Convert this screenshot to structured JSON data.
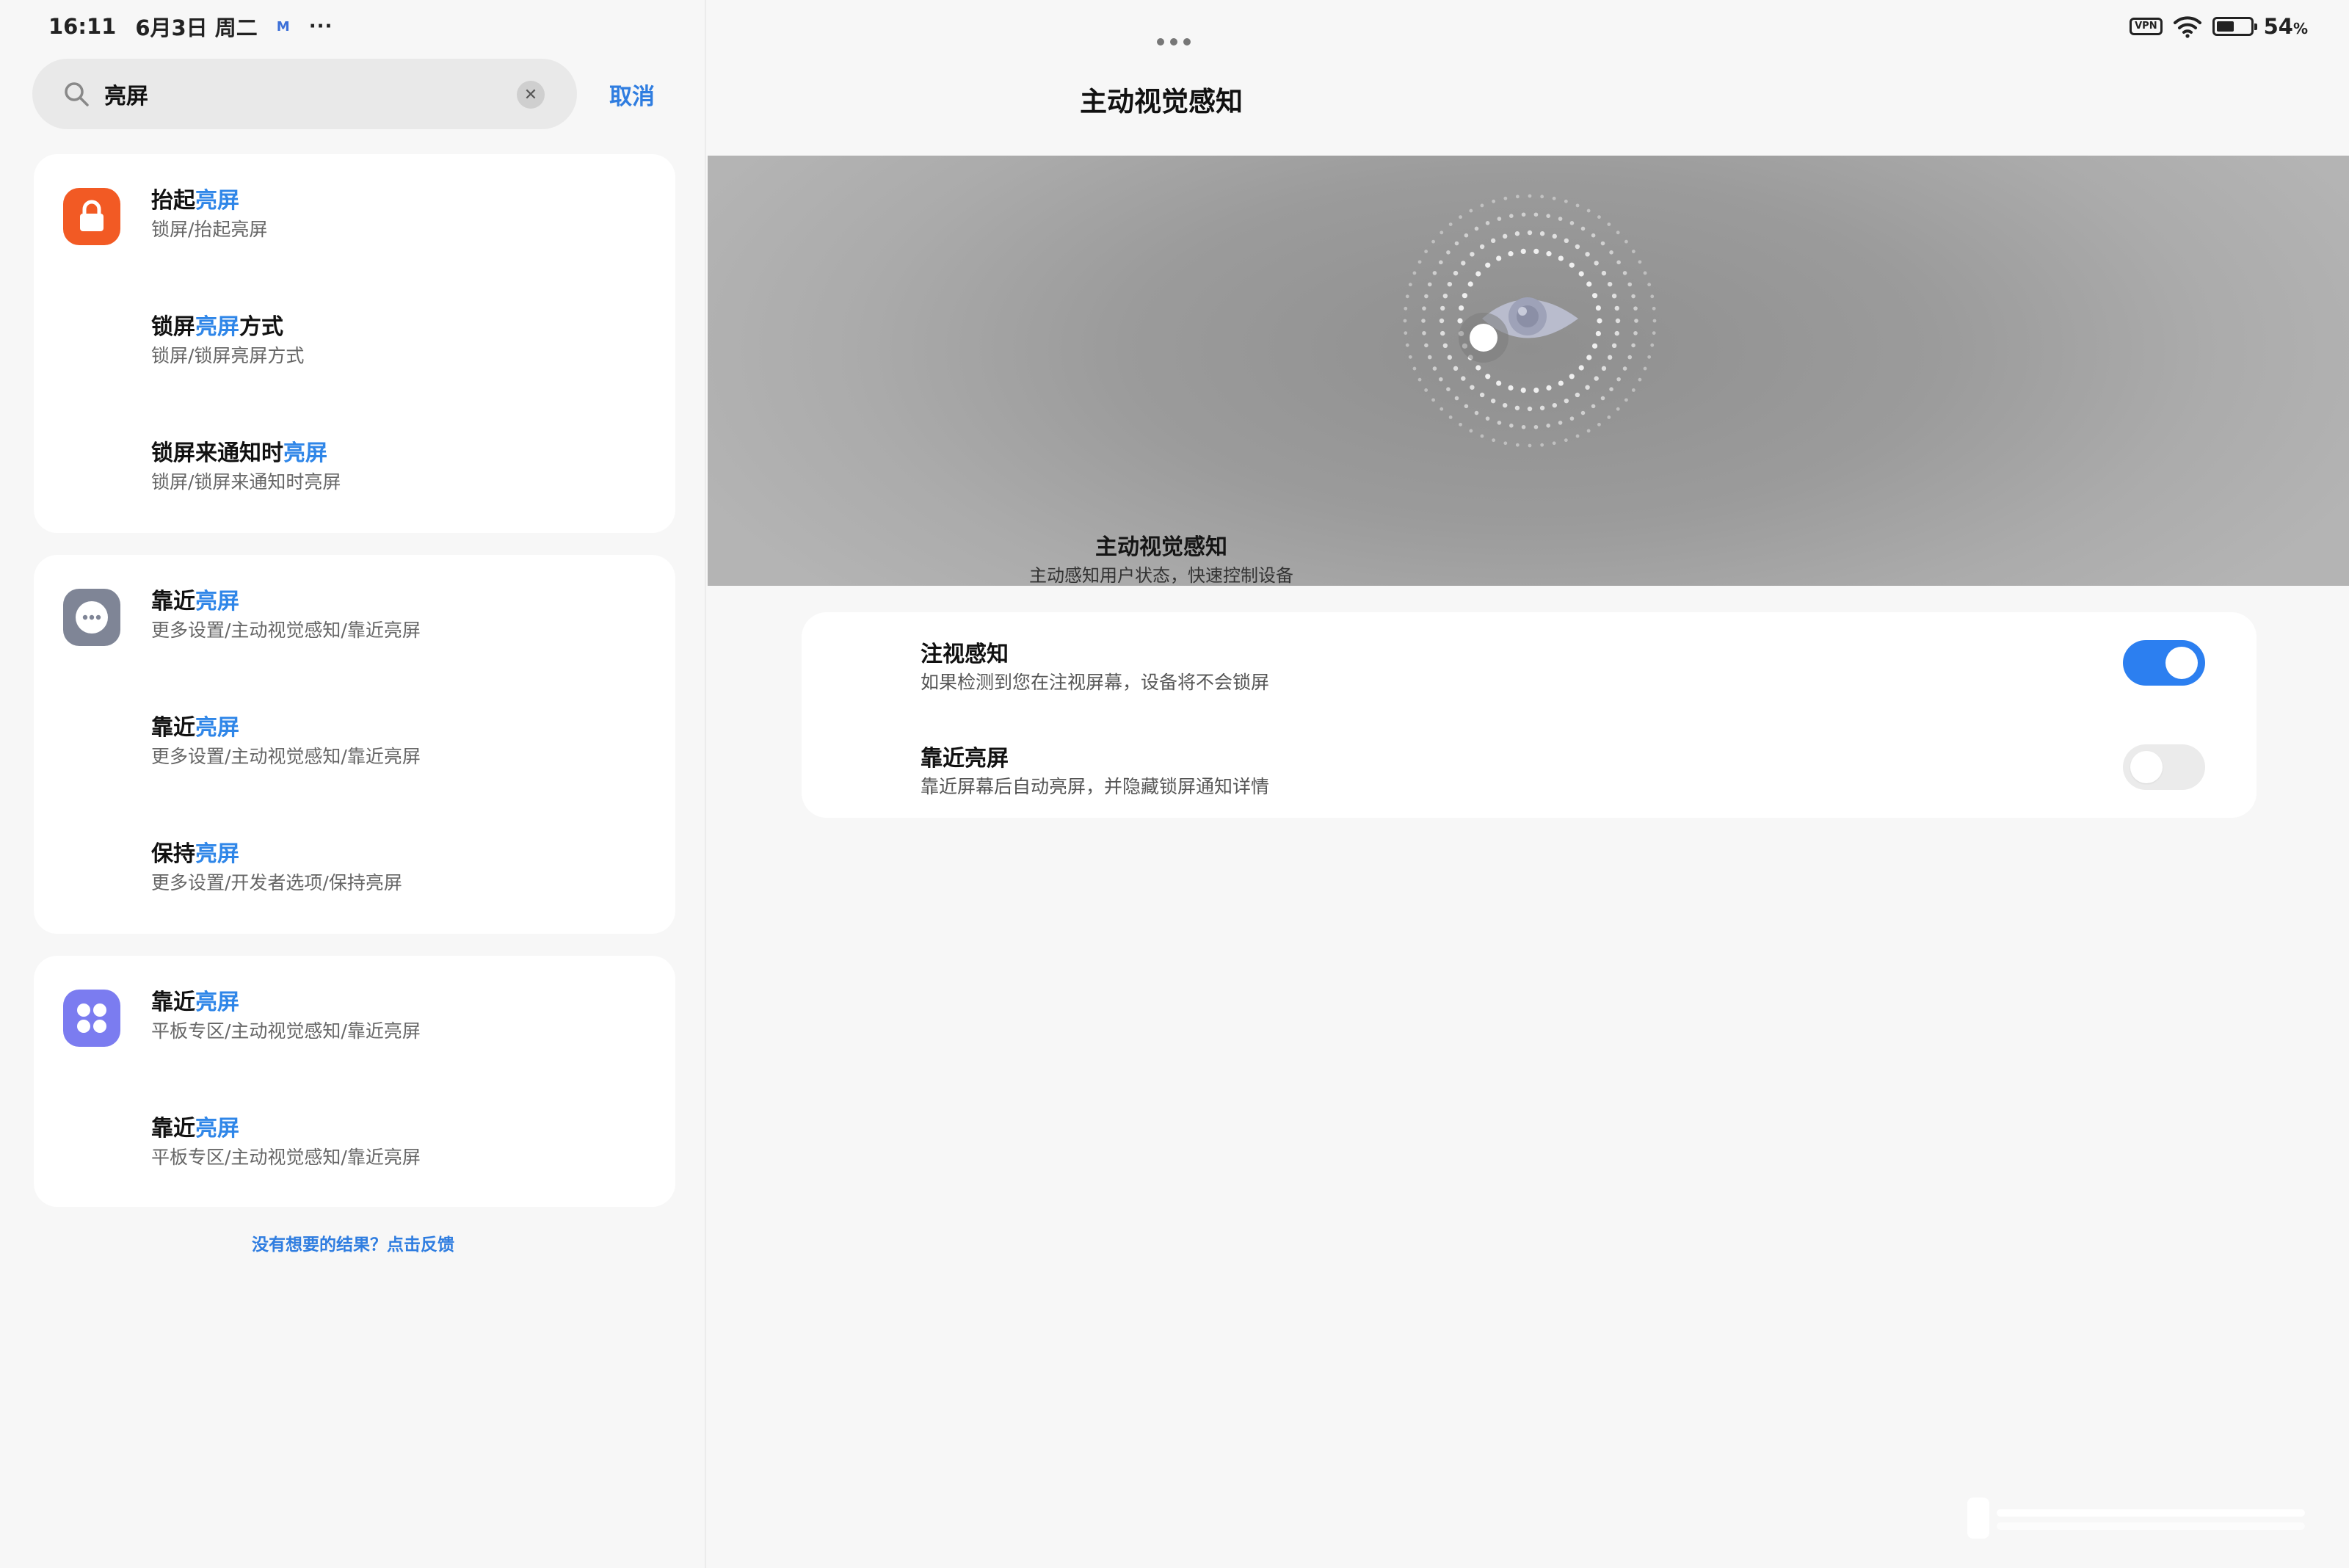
{
  "status_bar": {
    "time": "16:11",
    "date": "6月3日 周二",
    "notification_icon": "M",
    "more_indicator": "···",
    "vpn_label": "VPN",
    "battery_percent": "54",
    "battery_unit": "%"
  },
  "search": {
    "query": "亮屏",
    "cancel_label": "取消"
  },
  "results": [
    {
      "group": "lock-screen",
      "icon": "lock-icon",
      "icon_color": "#f25a24",
      "items": [
        {
          "prefix": "抬起",
          "highlight": "亮屏",
          "suffix": "",
          "path": "锁屏/抬起亮屏"
        },
        {
          "prefix": "锁屏",
          "highlight": "亮屏",
          "suffix": "方式",
          "path": "锁屏/锁屏亮屏方式"
        },
        {
          "prefix": "锁屏来通知时",
          "highlight": "亮屏",
          "suffix": "",
          "path": "锁屏/锁屏来通知时亮屏"
        }
      ]
    },
    {
      "group": "more-settings",
      "icon": "more-settings-icon",
      "icon_color": "#7f8596",
      "items": [
        {
          "prefix": "靠近",
          "highlight": "亮屏",
          "suffix": "",
          "path": "更多设置/主动视觉感知/靠近亮屏"
        },
        {
          "prefix": "靠近",
          "highlight": "亮屏",
          "suffix": "",
          "path": "更多设置/主动视觉感知/靠近亮屏"
        },
        {
          "prefix": "保持",
          "highlight": "亮屏",
          "suffix": "",
          "path": "更多设置/开发者选项/保持亮屏"
        }
      ]
    },
    {
      "group": "tablet-zone",
      "icon": "tablet-zone-icon",
      "icon_color": "#7b7cf0",
      "items": [
        {
          "prefix": "靠近",
          "highlight": "亮屏",
          "suffix": "",
          "path": "平板专区/主动视觉感知/靠近亮屏"
        },
        {
          "prefix": "靠近",
          "highlight": "亮屏",
          "suffix": "",
          "path": "平板专区/主动视觉感知/靠近亮屏"
        }
      ]
    }
  ],
  "feedback_link": "没有想要的结果？点击反馈",
  "detail": {
    "title": "主动视觉感知",
    "hero_title": "主动视觉感知",
    "hero_subtitle": "主动感知用户状态，快速控制设备",
    "settings": [
      {
        "title": "注视感知",
        "description": "如果检测到您在注视屏幕，设备将不会锁屏",
        "enabled": true
      },
      {
        "title": "靠近亮屏",
        "description": "靠近屏幕后自动亮屏，并隐藏锁屏通知详情",
        "enabled": false
      }
    ]
  },
  "colors": {
    "accent": "#2f86e8",
    "toggle_on": "#2c7ff0",
    "toggle_off": "#ebebeb"
  }
}
